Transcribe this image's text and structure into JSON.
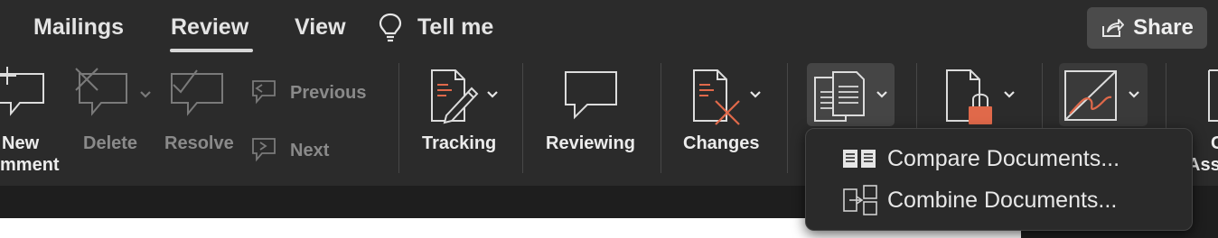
{
  "tabs": [
    {
      "label": "Mailings"
    },
    {
      "label": "Review",
      "selected": true
    },
    {
      "label": "View"
    },
    {
      "label": "Tell me",
      "icon": "lightbulb-icon"
    }
  ],
  "share": {
    "label": "Share",
    "icon": "share-icon"
  },
  "ribbon": {
    "new_comment": {
      "line1": "New",
      "line2": "mment"
    },
    "delete": {
      "label": "Delete"
    },
    "resolve": {
      "label": "Resolve"
    },
    "previous": {
      "label": "Previous"
    },
    "next": {
      "label": "Next"
    },
    "tracking": {
      "label": "Tracking"
    },
    "reviewing": {
      "label": "Reviewing"
    },
    "changes": {
      "label": "Changes"
    },
    "accessibility_partial": {
      "line1": "C",
      "line2": "Ass"
    }
  },
  "compare_menu": {
    "items": [
      {
        "label": "Compare Documents...",
        "icon": "compare-documents-icon"
      },
      {
        "label": "Combine Documents...",
        "icon": "combine-documents-icon"
      }
    ]
  },
  "colors": {
    "accent": "#e0694a",
    "background": "#2b2b2b"
  }
}
